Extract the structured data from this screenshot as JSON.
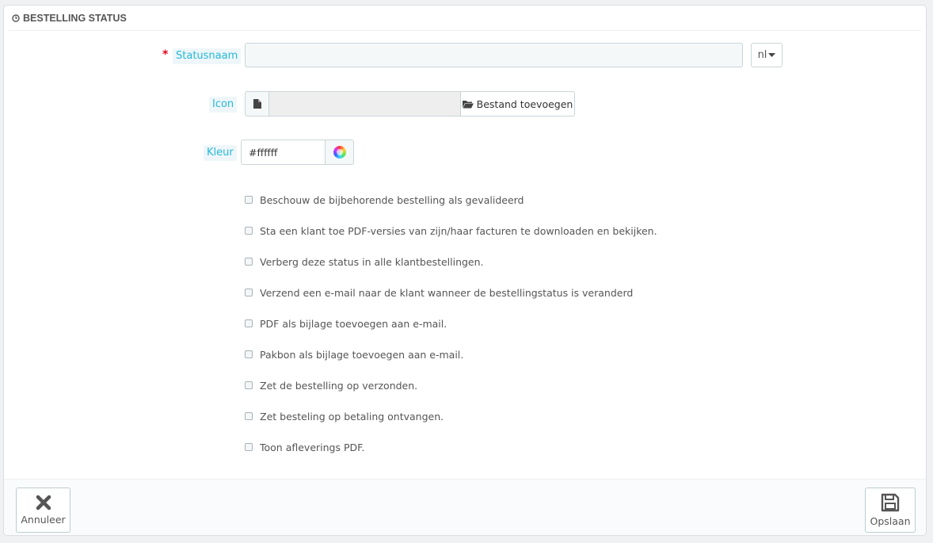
{
  "panel": {
    "title": "BESTELLING STATUS",
    "title_icon": "clock-icon"
  },
  "form": {
    "status_name": {
      "label": "Statusnaam",
      "required_mark": "*",
      "value": "",
      "language": "nl"
    },
    "icon": {
      "label": "Icon",
      "file_value": "",
      "button_label": "Bestand toevoegen",
      "file_icon": "file-icon",
      "button_icon": "folder-open-icon"
    },
    "color": {
      "label": "Kleur",
      "value": "#ffffff",
      "picker_icon": "color-wheel-icon"
    },
    "checkboxes": [
      {
        "label": "Beschouw de bijbehorende bestelling als gevalideerd",
        "checked": false
      },
      {
        "label": "Sta een klant toe PDF-versies van zijn/haar facturen te downloaden en bekijken.",
        "checked": false
      },
      {
        "label": "Verberg deze status in alle klantbestellingen.",
        "checked": false
      },
      {
        "label": "Verzend een e-mail naar de klant wanneer de bestellingstatus is veranderd",
        "checked": false
      },
      {
        "label": "PDF als bijlage toevoegen aan e-mail.",
        "checked": false
      },
      {
        "label": "Pakbon als bijlage toevoegen aan e-mail.",
        "checked": false
      },
      {
        "label": "Zet de bestelling op verzonden.",
        "checked": false
      },
      {
        "label": "Zet besteling op betaling ontvangen.",
        "checked": false
      },
      {
        "label": "Toon afleverings PDF.",
        "checked": false
      }
    ]
  },
  "footer": {
    "cancel_label": "Annuleer",
    "cancel_icon": "close-icon",
    "save_label": "Opslaan",
    "save_icon": "save-icon"
  },
  "colors": {
    "label_accent": "#25b9d7",
    "required": "#e3001b",
    "page_bg": "#eff1f2"
  }
}
